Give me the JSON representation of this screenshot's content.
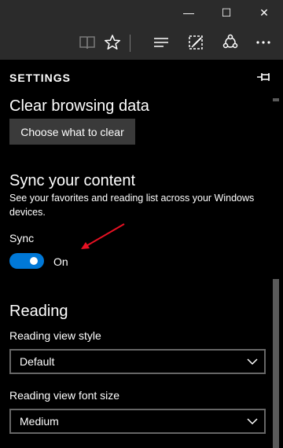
{
  "window": {
    "minimize_glyph": "—",
    "maximize_glyph": "☐",
    "close_glyph": "✕"
  },
  "toolbar": {
    "icons": [
      "reading-view-icon",
      "favorite-star-icon",
      "hub-icon",
      "web-note-icon",
      "share-icon",
      "more-icon"
    ]
  },
  "settings": {
    "title": "SETTINGS",
    "clear_browsing": {
      "heading": "Clear browsing data",
      "button": "Choose what to clear"
    },
    "sync": {
      "heading": "Sync your content",
      "description": "See your favorites and reading list across your Windows devices.",
      "label": "Sync",
      "state": "On",
      "enabled": true
    },
    "reading": {
      "heading": "Reading",
      "style_label": "Reading view style",
      "style_value": "Default",
      "font_label": "Reading view font size",
      "font_value": "Medium"
    }
  },
  "colors": {
    "accent": "#0078d7",
    "annotation_arrow": "#e81123"
  }
}
